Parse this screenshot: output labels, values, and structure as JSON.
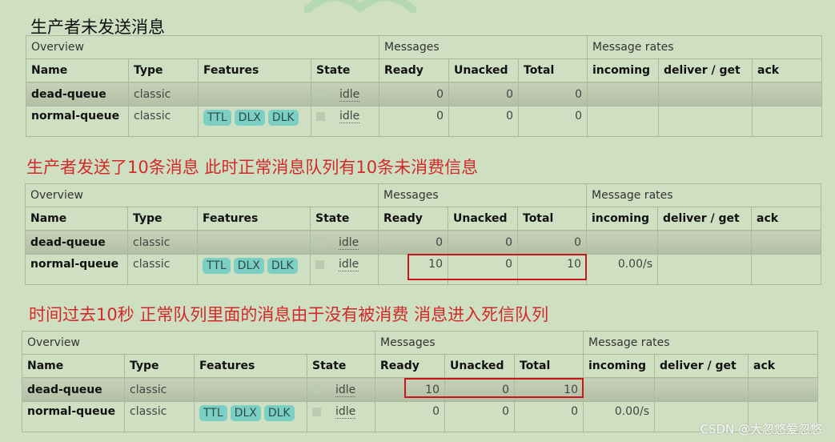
{
  "sections": [
    {
      "title": "生产者未发送消息",
      "title_color": "#111111",
      "rows": [
        {
          "name": "dead-queue",
          "type": "classic",
          "features": [],
          "state": "idle",
          "ready": "0",
          "unacked": "0",
          "total": "0",
          "incoming": "",
          "deliver_get": "",
          "ack": ""
        },
        {
          "name": "normal-queue",
          "type": "classic",
          "features": [
            "TTL",
            "DLX",
            "DLK"
          ],
          "state": "idle",
          "ready": "0",
          "unacked": "0",
          "total": "0",
          "incoming": "",
          "deliver_get": "",
          "ack": ""
        }
      ],
      "highlight_row": null
    },
    {
      "title": "生产者发送了10条消息 此时正常消息队列有10条未消费信息",
      "title_color": "#d02a2a",
      "rows": [
        {
          "name": "dead-queue",
          "type": "classic",
          "features": [],
          "state": "idle",
          "ready": "0",
          "unacked": "0",
          "total": "0",
          "incoming": "",
          "deliver_get": "",
          "ack": ""
        },
        {
          "name": "normal-queue",
          "type": "classic",
          "features": [
            "TTL",
            "DLX",
            "DLK"
          ],
          "state": "idle",
          "ready": "10",
          "unacked": "0",
          "total": "10",
          "incoming": "0.00/s",
          "deliver_get": "",
          "ack": ""
        }
      ],
      "highlight_row": 1
    },
    {
      "title": "时间过去10秒  正常队列里面的消息由于没有被消费 消息进入死信队列",
      "title_color": "#d02a2a",
      "rows": [
        {
          "name": "dead-queue",
          "type": "classic",
          "features": [],
          "state": "idle",
          "ready": "10",
          "unacked": "0",
          "total": "10",
          "incoming": "",
          "deliver_get": "",
          "ack": ""
        },
        {
          "name": "normal-queue",
          "type": "classic",
          "features": [
            "TTL",
            "DLX",
            "DLK"
          ],
          "state": "idle",
          "ready": "0",
          "unacked": "0",
          "total": "0",
          "incoming": "0.00/s",
          "deliver_get": "",
          "ack": ""
        }
      ],
      "highlight_row": 0
    }
  ],
  "groups": {
    "overview": "Overview",
    "messages": "Messages",
    "rates": "Message rates"
  },
  "columns": [
    "Name",
    "Type",
    "Features",
    "State",
    "Ready",
    "Unacked",
    "Total",
    "incoming",
    "deliver / get",
    "ack"
  ],
  "highlight_color": "#c8161d",
  "tag_color": "#7ccfc5",
  "watermark": "CSDN @大忽悠爱忽悠"
}
